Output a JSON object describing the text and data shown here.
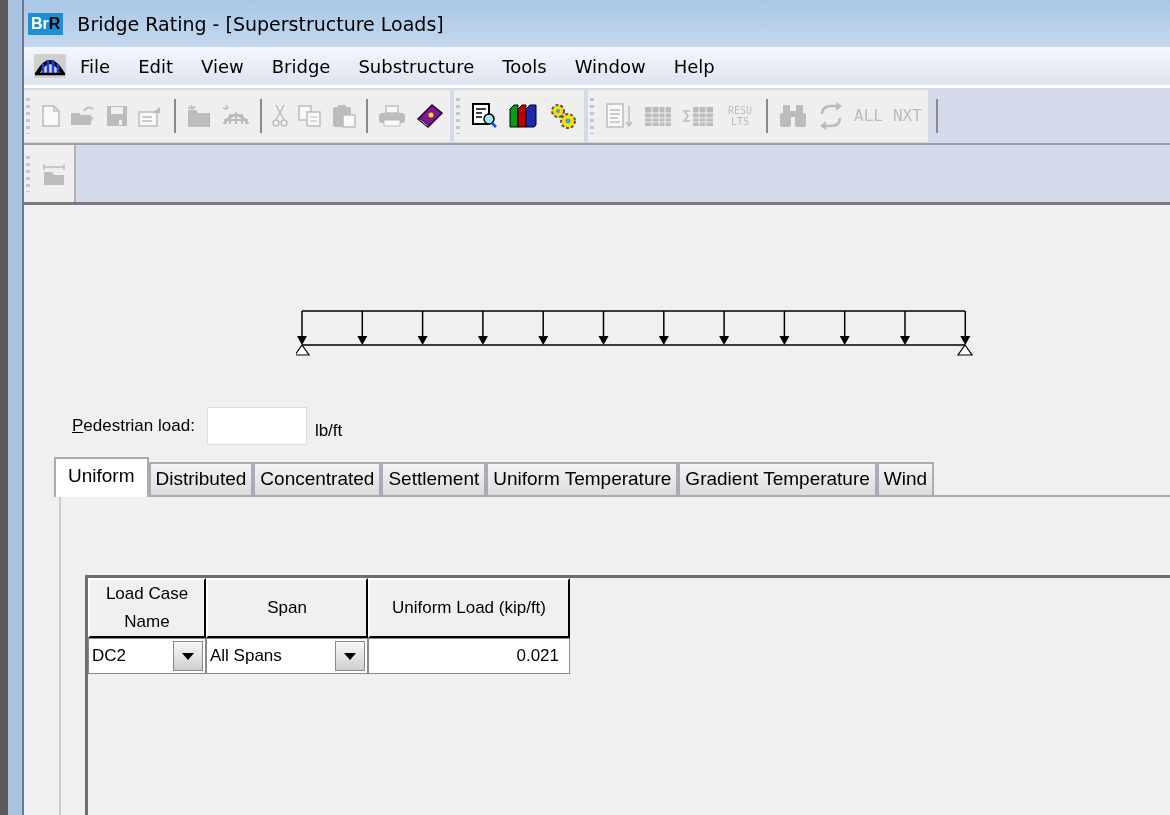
{
  "window": {
    "title": "Bridge Rating - [Superstructure Loads]",
    "logo": {
      "part_1": "Br",
      "part_2": "R"
    }
  },
  "menu": [
    "File",
    "Edit",
    "View",
    "Bridge",
    "Substructure",
    "Tools",
    "Window",
    "Help"
  ],
  "toolbars": [
    {
      "groups": [
        [
          {
            "kind": "icon",
            "disabled": true
          },
          {
            "kind": "icon",
            "disabled": true
          },
          {
            "kind": "icon",
            "disabled": true
          },
          {
            "kind": "icon",
            "disabled": true
          }
        ],
        [
          {
            "kind": "icon",
            "disabled": true
          },
          {
            "kind": "icon",
            "disabled": true
          }
        ],
        [
          {
            "kind": "icon",
            "disabled": true
          },
          {
            "kind": "icon",
            "disabled": true
          },
          {
            "kind": "icon",
            "disabled": true
          }
        ],
        [
          {
            "kind": "icon",
            "disabled": true
          },
          {
            "kind": "icon",
            "disabled": false
          }
        ]
      ]
    },
    {
      "groups": [
        [
          {
            "kind": "icon",
            "disabled": false
          },
          {
            "kind": "icon",
            "disabled": false
          },
          {
            "kind": "icon",
            "disabled": false
          }
        ]
      ]
    },
    {
      "groups": [
        [
          {
            "kind": "icon",
            "disabled": true
          },
          {
            "kind": "icon",
            "disabled": true
          },
          {
            "kind": "icon",
            "disabled": true
          },
          {
            "kind": "text",
            "label": "RESU LTS",
            "disabled": true
          }
        ],
        [
          {
            "kind": "icon",
            "disabled": true
          },
          {
            "kind": "icon",
            "disabled": true
          },
          {
            "kind": "text",
            "label": "ALL",
            "disabled": true
          },
          {
            "kind": "text",
            "label": "NXT",
            "disabled": true
          }
        ]
      ]
    }
  ],
  "second_toolbar": {
    "buttons": [
      {
        "kind": "icon",
        "disabled": true
      }
    ]
  },
  "pedestrian_load": {
    "label": "Pedestrian load:",
    "unit": "lb/ft"
  },
  "tabs": [
    {
      "label": "Uniform",
      "selected": true
    },
    {
      "label": "Distributed",
      "selected": false
    },
    {
      "label": "Concentrated",
      "selected": false
    },
    {
      "label": "Settlement",
      "selected": false
    },
    {
      "label": "Uniform Temperature",
      "selected": false
    },
    {
      "label": "Gradient Temperature",
      "selected": false
    },
    {
      "label": "Wind",
      "selected": false
    }
  ],
  "table": {
    "columns": [
      "Load Case Name",
      "Span",
      "Uniform Load (kip/ft)"
    ],
    "rows": [
      {
        "load_case_name": "DC2",
        "span": "All Spans",
        "uniform_load": "0.021"
      }
    ]
  }
}
